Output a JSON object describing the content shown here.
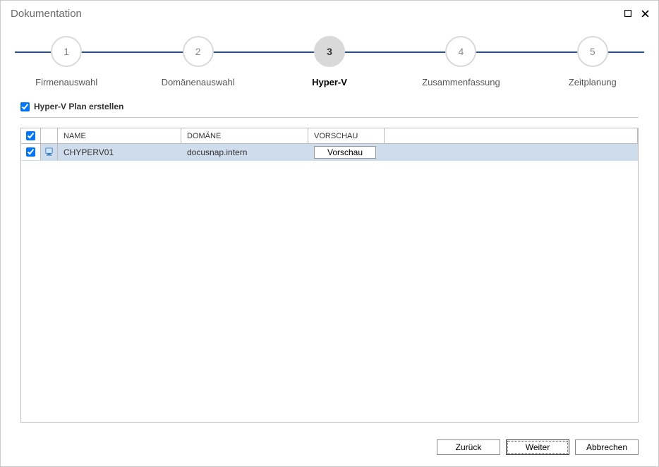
{
  "window": {
    "title": "Dokumentation"
  },
  "stepper": {
    "steps": [
      {
        "num": "1",
        "label": "Firmenauswahl",
        "active": false
      },
      {
        "num": "2",
        "label": "Domänenauswahl",
        "active": false
      },
      {
        "num": "3",
        "label": "Hyper-V",
        "active": true
      },
      {
        "num": "4",
        "label": "Zusammenfassung",
        "active": false
      },
      {
        "num": "5",
        "label": "Zeitplanung",
        "active": false
      }
    ]
  },
  "option": {
    "checked": true,
    "label": "Hyper-V Plan erstellen"
  },
  "grid": {
    "headers": {
      "name": "NAME",
      "domain": "DOMÄNE",
      "preview": "VORSCHAU"
    },
    "rows": [
      {
        "checked": true,
        "name": "CHYPERV01",
        "domain": "docusnap.intern",
        "preview_btn": "Vorschau"
      }
    ]
  },
  "footer": {
    "back": "Zurück",
    "next": "Weiter",
    "cancel": "Abbrechen"
  }
}
